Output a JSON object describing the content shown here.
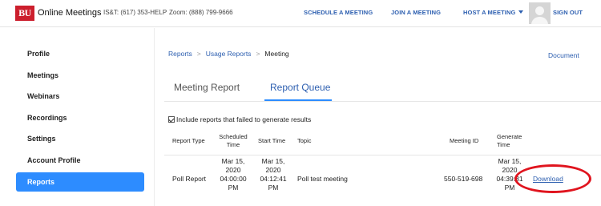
{
  "header": {
    "logo_text": "BU",
    "brand": "Online Meetings",
    "ist_phone": "IS&T: (617) 353-HELP",
    "zoom_phone": "Zoom: (888) 799-9666",
    "nav": {
      "schedule": "SCHEDULE A MEETING",
      "join": "JOIN A MEETING",
      "host": "HOST A MEETING",
      "signout": "SIGN OUT"
    }
  },
  "sidebar": {
    "items": [
      {
        "label": "Profile"
      },
      {
        "label": "Meetings"
      },
      {
        "label": "Webinars"
      },
      {
        "label": "Recordings"
      },
      {
        "label": "Settings"
      },
      {
        "label": "Account Profile"
      },
      {
        "label": "Reports",
        "active": true
      }
    ]
  },
  "breadcrumb": {
    "items": [
      "Reports",
      "Usage Reports",
      "Meeting"
    ],
    "separator": ">"
  },
  "document_link": "Document",
  "tabs": {
    "meeting_report": "Meeting Report",
    "report_queue": "Report Queue",
    "active": "report_queue"
  },
  "options": {
    "include_failed_label": "Include reports that failed to generate results",
    "include_failed_checked": true
  },
  "table": {
    "headers": {
      "report_type": "Report Type",
      "scheduled_1": "Scheduled",
      "scheduled_2": "Time",
      "start_time": "Start Time",
      "topic": "Topic",
      "meeting_id": "Meeting ID",
      "generate_1": "Generate",
      "generate_2": "Time"
    },
    "rows": [
      {
        "report_type": "Poll Report",
        "scheduled": [
          "Mar 15,",
          "2020",
          "04:00:00",
          "PM"
        ],
        "start": [
          "Mar 15,",
          "2020",
          "04:12:41",
          "PM"
        ],
        "topic": "Poll test meeting",
        "meeting_id": "550-519-698",
        "generate": [
          "Mar 15,",
          "2020",
          "04:39:31",
          "PM"
        ],
        "action": "Download"
      }
    ]
  },
  "colors": {
    "brand_red": "#cc1f2d",
    "link_blue": "#2d5fb0",
    "active_blue": "#2d8cff",
    "highlight_ring": "#e0141e"
  }
}
